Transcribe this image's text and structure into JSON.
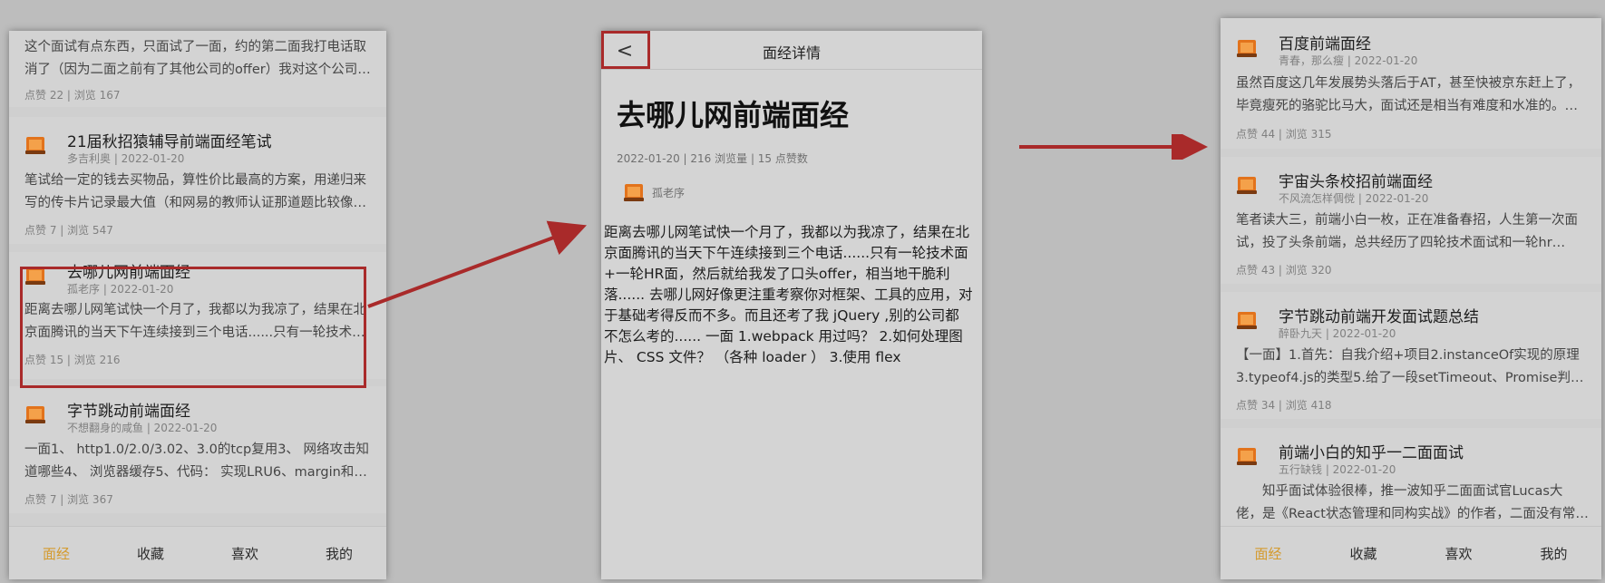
{
  "left_screen": {
    "cards": [
      {
        "title": "",
        "meta": "",
        "desc": "这个面试有点东西，只面试了一面，约的第二面我打电话取消了（因为二面之前有了其他公司的offer）我对这个公司做过...",
        "stats": "点赞 22 | 浏览 167"
      },
      {
        "title": "21届秋招猿辅导前端面经笔试",
        "meta": "多吉利奥 | 2022-01-20",
        "desc": "笔试给一定的钱去买物品，算性价比最高的方案，用递归来写的传卡片记录最大值（和网易的教师认证那道题比较像） 解...",
        "stats": "点赞 7 | 浏览 547"
      },
      {
        "title": "去哪儿网前端面经",
        "meta": "孤老序 | 2022-01-20",
        "desc": "距离去哪儿网笔试快一个月了，我都以为我凉了，结果在北京面腾讯的当天下午连续接到三个电话......只有一轮技术面+一...",
        "stats": "点赞 15 | 浏览 216"
      },
      {
        "title": "字节跳动前端面经",
        "meta": "不想翻身的咸鱼 | 2022-01-20",
        "desc": "一面1、 http1.0/2.0/3.02、3.0的tcp复用3、 网络攻击知道哪些4、 浏览器缓存5、代码： 实现LRU6、margin和paddin...",
        "stats": "点赞 7 | 浏览 367"
      }
    ]
  },
  "tabs": [
    {
      "label": "面经",
      "active": true
    },
    {
      "label": "收藏",
      "active": false
    },
    {
      "label": "喜欢",
      "active": false
    },
    {
      "label": "我的",
      "active": false
    }
  ],
  "detail": {
    "back_glyph": "<",
    "header_title": "面经详情",
    "title": "去哪儿网前端面经",
    "meta": "2022-01-20 | 216 浏览量 | 15 点赞数",
    "author": "孤老序",
    "content": "距离去哪儿网笔试快一个月了，我都以为我凉了，结果在北京面腾讯的当天下午连续接到三个电话......只有一轮技术面+一轮HR面，然后就给我发了口头offer，相当地干脆利落...... 去哪儿网好像更注重考察你对框架、工具的应用，对于基础考得反而不多。而且还考了我 jQuery ,别的公司都不怎么考的...... 一面 1.webpack 用过吗？ 2.如何处理图片、 CSS 文件？ （各种 loader ） 3.使用 flex"
  },
  "right_screen": {
    "cards": [
      {
        "title": "百度前端面经",
        "meta": "青春，那么瘦 | 2022-01-20",
        "desc": "虽然百度这几年发展势头落后于AT，甚至快被京东赶上了，毕竟瘦死的骆驼比马大，面试还是相当有难度和水准的。一面...",
        "stats": "点赞 44 | 浏览 315"
      },
      {
        "title": "宇宙头条校招前端面经",
        "meta": "不风流怎样倜傥 | 2022-01-20",
        "desc": "笔者读大三，前端小白一枚，正在准备春招，人生第一次面试，投了头条前端，总共经历了四轮技术面试和一轮hr面，...",
        "stats": "点赞 43 | 浏览 320"
      },
      {
        "title": "字节跳动前端开发面试题总结",
        "meta": "醉卧九天 | 2022-01-20",
        "desc": "【一面】1.首先：自我介绍+项目2.instanceOf实现的原理3.typeof4.js的类型5.给了一段setTimeout、Promise判断输...",
        "stats": "点赞 34 | 浏览 418"
      },
      {
        "title": "前端小白的知乎一二面面试",
        "meta": "五行缺钱 | 2022-01-20",
        "desc": "知乎面试体验很棒，推一波知乎二面面试官Lucas大佬，是《React状态管理和同构实战》的作者，二面没有常规的...",
        "stats": ""
      }
    ]
  },
  "colors": {
    "accent": "#d49a2c",
    "highlight": "#a92a2a",
    "icon_orange": "#e2731c"
  }
}
